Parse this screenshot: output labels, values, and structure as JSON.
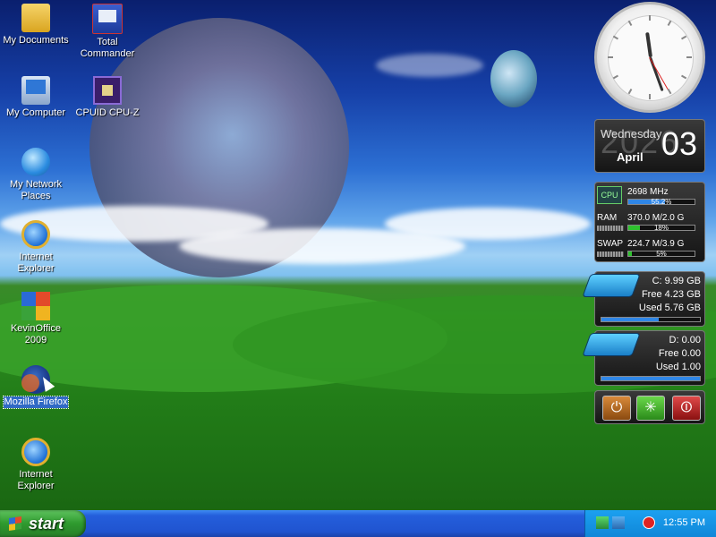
{
  "desktop": {
    "icons": [
      {
        "label": "My Documents"
      },
      {
        "label": "Total Commander"
      },
      {
        "label": "My Computer"
      },
      {
        "label": "CPUID CPU-Z"
      },
      {
        "label": "My Network Places"
      },
      {
        "label": "Internet Explorer"
      },
      {
        "label": "KevinOffice 2009"
      },
      {
        "label": "Mozilla Firefox"
      },
      {
        "label": "Internet Explorer"
      }
    ]
  },
  "calendar": {
    "year_watermark": "2026",
    "weekday": "Wednesday",
    "month": "April",
    "day": "03"
  },
  "system_monitor": {
    "cpu_label": "CPU",
    "cpu_freq": "2698 MHz",
    "cpu_pct_text": "55.2%",
    "cpu_pct": 55.2,
    "ram_label": "RAM",
    "ram_value": "370.0 M/2.0 G",
    "ram_pct_text": "18%",
    "ram_pct": 18,
    "swap_label": "SWAP",
    "swap_value": "224.7 M/3.9 G",
    "swap_pct_text": "5%",
    "swap_pct": 5
  },
  "drives": [
    {
      "line1": "C:  9.99 GB",
      "line2": "Free 4.23 GB",
      "line3": "Used 5.76 GB",
      "used_fraction": 0.58
    },
    {
      "line1": "D:  0.00",
      "line2": "Free 0.00",
      "line3": "Used 1.00",
      "used_fraction": 1.0
    }
  ],
  "power": {
    "logoff_glyph": "⏻",
    "restart_glyph": "✳",
    "shutdown_glyph": "⏼"
  },
  "taskbar": {
    "start_label": "start",
    "time": "12:55 PM"
  }
}
